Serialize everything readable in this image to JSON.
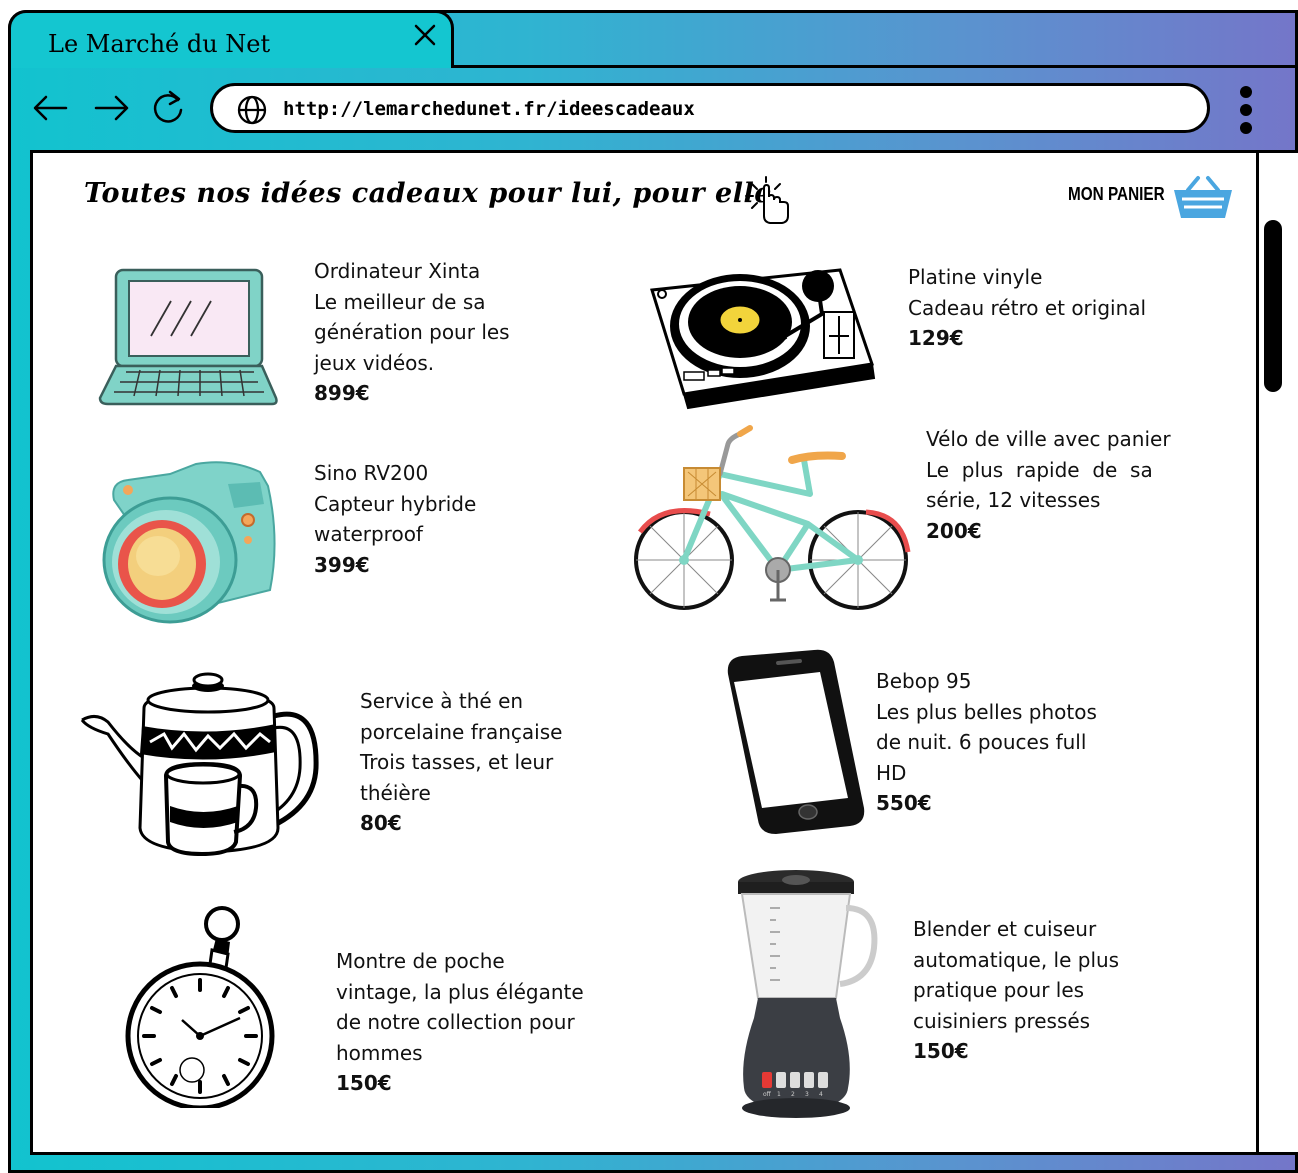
{
  "tab": {
    "title": "Le Marché du Net"
  },
  "address_bar": {
    "url": "http://lemarchedunet.fr/ideescadeaux"
  },
  "page": {
    "heading": "Toutes nos idées cadeaux pour lui, pour elle",
    "cart_label": "MON PANIER"
  },
  "products": [
    {
      "lines": [
        "Ordinateur Xinta",
        "Le meilleur de sa",
        "génération pour les",
        "jeux vidéos."
      ],
      "price": "899€",
      "icon": "laptop-icon"
    },
    {
      "lines": [
        "Platine vinyle",
        "Cadeau rétro et original"
      ],
      "price": "129€",
      "icon": "turntable-icon"
    },
    {
      "lines": [
        "Sino RV200",
        "Capteur hybride",
        "waterproof"
      ],
      "price": "399€",
      "icon": "camera-icon"
    },
    {
      "lines": [
        "Vélo de ville avec panier",
        "Le  plus  rapide  de  sa",
        "série, 12 vitesses"
      ],
      "price": "200€",
      "icon": "bicycle-icon"
    },
    {
      "lines": [
        "Service à thé en",
        "porcelaine française",
        "Trois tasses, et leur",
        "théière"
      ],
      "price": "80€",
      "icon": "teapot-icon"
    },
    {
      "lines": [
        "Bebop 95",
        "Les plus belles photos",
        "de nuit. 6 pouces full",
        "HD"
      ],
      "price": "550€",
      "icon": "smartphone-icon"
    },
    {
      "lines": [
        "Montre de poche",
        "vintage, la plus élégante",
        "de notre collection pour",
        "hommes"
      ],
      "price": "150€",
      "icon": "pocket-watch-icon"
    },
    {
      "lines": [
        "Blender et cuiseur",
        "automatique, le plus",
        "pratique pour les",
        "cuisiniers pressés"
      ],
      "price": "150€",
      "icon": "blender-icon"
    }
  ],
  "blender_dial": {
    "labels": [
      "off",
      "1",
      "2",
      "3",
      "4"
    ]
  },
  "colors": {
    "accent_teal": "#14c6d0",
    "accent_purple": "#7476c9",
    "cart_blue": "#4aa6e0"
  }
}
